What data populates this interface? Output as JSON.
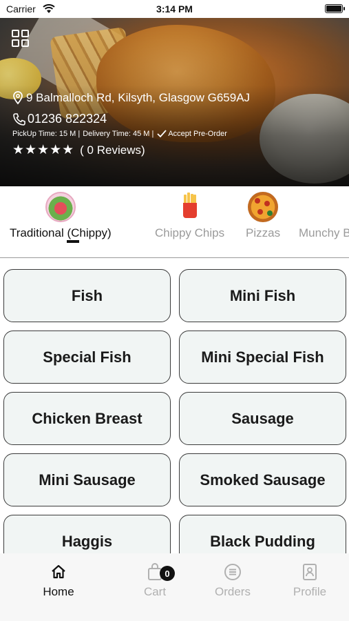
{
  "status_bar": {
    "carrier": "Carrier",
    "time": "3:14 PM"
  },
  "store": {
    "address": "9 Balmalloch Rd, Kilsyth, Glasgow G659AJ",
    "phone": "01236 822324",
    "pickup_time": "PickUp Time: 15 M |",
    "delivery_time": "Delivery Time: 45 M |",
    "pre_order": "Accept Pre-Order",
    "stars": "★★★★★",
    "rating": 5,
    "reviews": "( 0 Reviews)"
  },
  "categories": [
    {
      "label": "Traditional (Chippy)",
      "icon": "traditional-icon",
      "active": true
    },
    {
      "label": "Chippy Chips",
      "icon": "fries-icon",
      "active": false
    },
    {
      "label": "Pizzas",
      "icon": "pizza-icon",
      "active": false
    },
    {
      "label": "Munchy B",
      "icon": "",
      "active": false
    }
  ],
  "items": [
    "Fish",
    "Mini Fish",
    "Special Fish",
    "Mini Special Fish",
    "Chicken Breast",
    "Sausage",
    "Mini Sausage",
    "Smoked Sausage",
    "Haggis",
    "Black Pudding"
  ],
  "tabbar": {
    "home": "Home",
    "cart": "Cart",
    "cart_count": "0",
    "orders": "Orders",
    "profile": "Profile"
  }
}
